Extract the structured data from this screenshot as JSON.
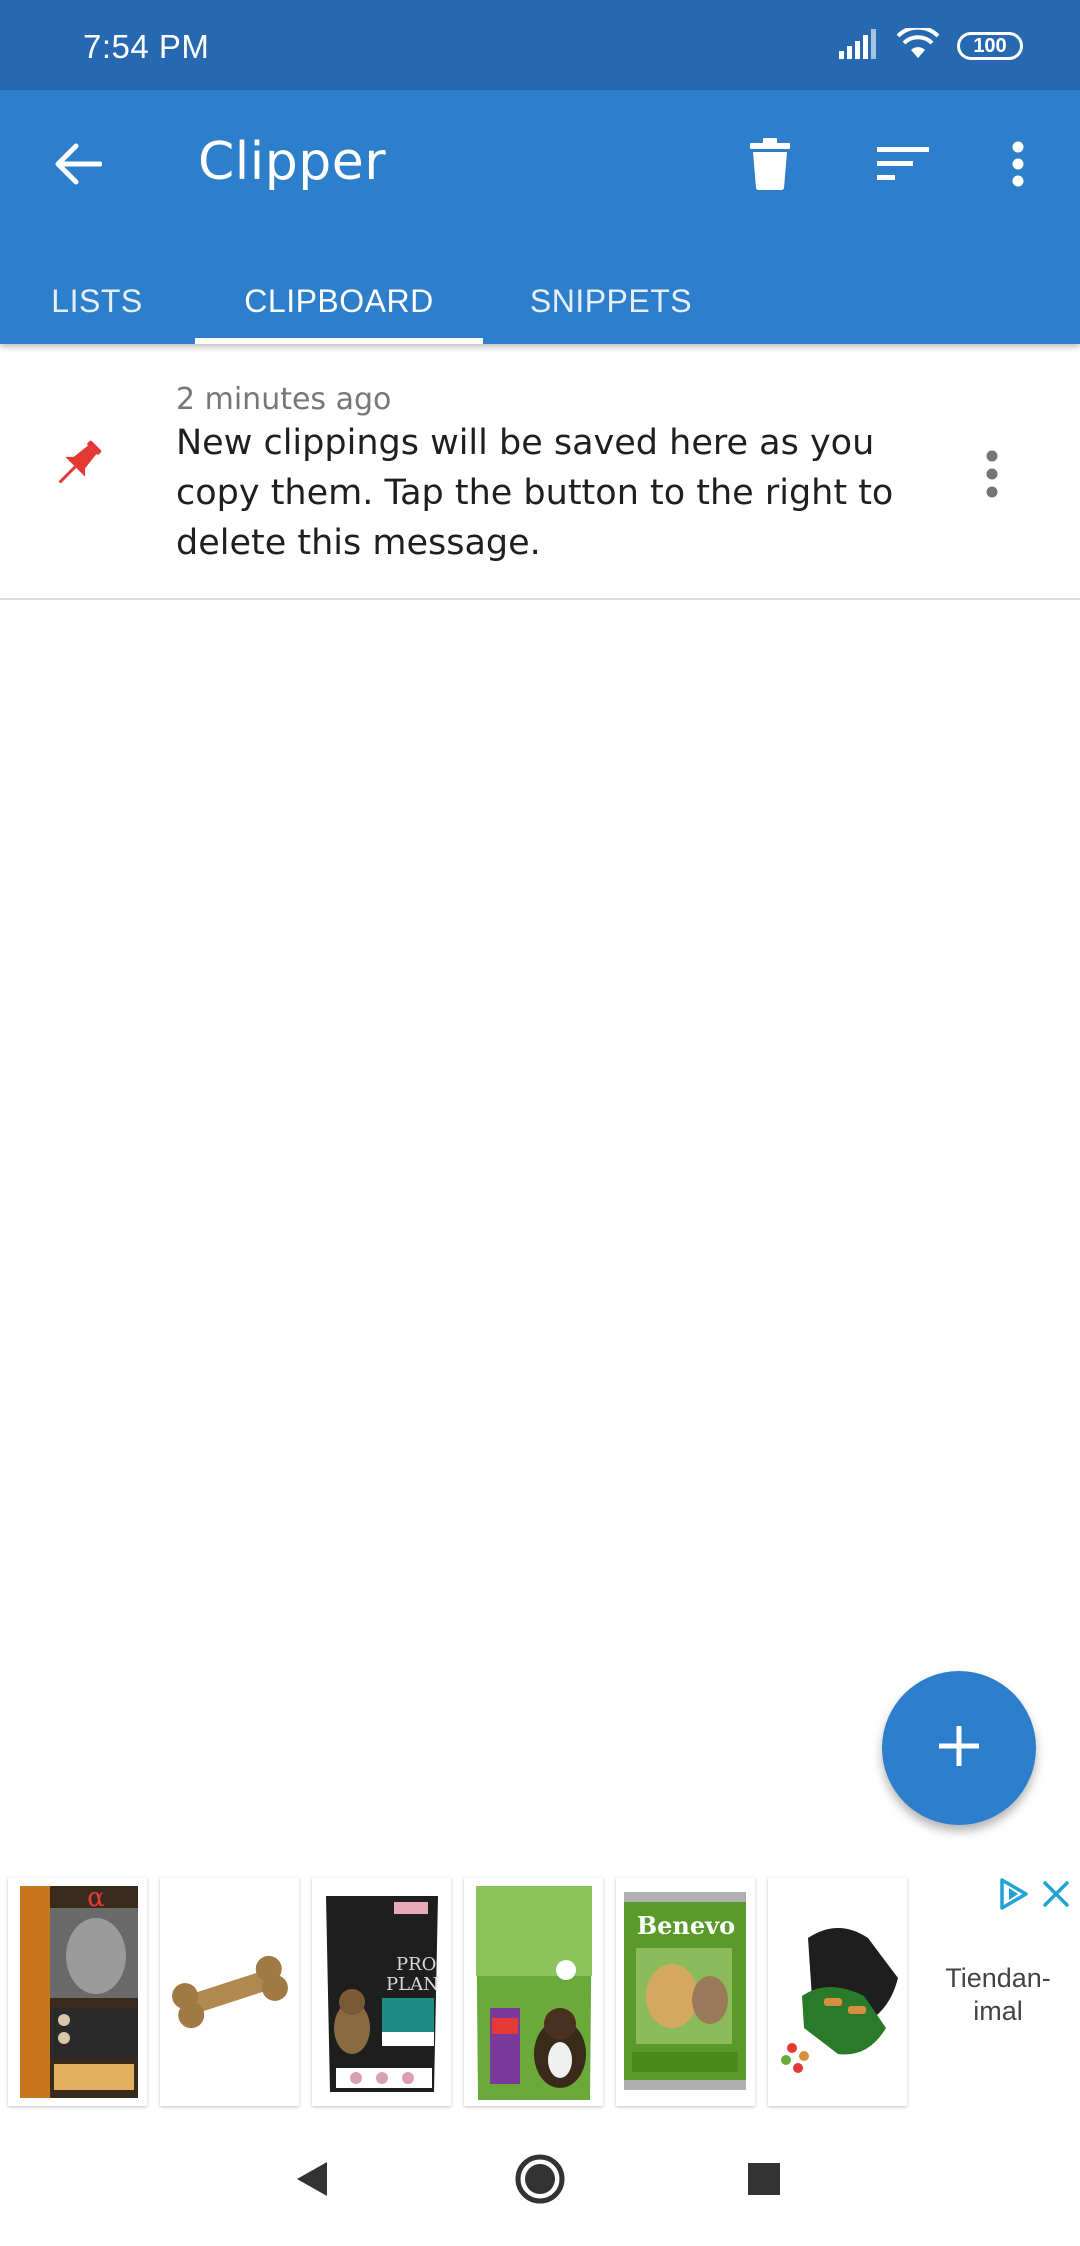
{
  "status_bar": {
    "time": "7:54 PM",
    "battery": "100",
    "signal_icon": "signal-icon",
    "wifi_icon": "wifi-icon"
  },
  "app_bar": {
    "title": "Clipper",
    "back_icon": "arrow-back-icon",
    "actions": [
      "trash-icon",
      "sort-icon",
      "more-vert-icon"
    ]
  },
  "tabs": [
    {
      "label": "LISTS",
      "selected": false
    },
    {
      "label": "CLIPBOARD",
      "selected": true
    },
    {
      "label": "SNIPPETS",
      "selected": false
    }
  ],
  "clipboard": {
    "items": [
      {
        "time": "2 minutes ago",
        "text": "New clippings will be saved here as you copy them. Tap the button to the right to delete this message.",
        "pinned": true,
        "pin_color": "#e53935"
      }
    ]
  },
  "fab": {
    "icon": "plus-icon"
  },
  "ad": {
    "products": [
      "dog-food-box-image",
      "chew-bone-image",
      "pro-plan-puppy-bag-image",
      "friskies-maxi-bag-image",
      "benevo-can-image",
      "waffle-maker-image"
    ],
    "advertiser": "Tiendan-\nimal",
    "info_icon": "adchoices-icon",
    "close_icon": "close-icon"
  },
  "nav_bar": {
    "buttons": [
      "back-triangle-icon",
      "home-circle-icon",
      "recents-square-icon"
    ]
  },
  "colors": {
    "status_bar": "#2769b1",
    "primary": "#2d7fcb",
    "pin": "#e53935"
  }
}
